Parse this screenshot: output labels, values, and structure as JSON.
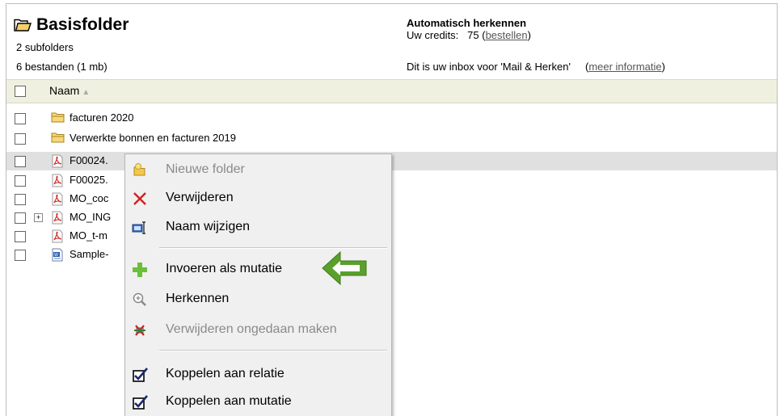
{
  "header": {
    "title": "Basisfolder",
    "subfolders": "2 subfolders",
    "files": "6 bestanden (1 mb)",
    "auto_title": "Automatisch herkennen",
    "credits_label": "Uw credits:",
    "credits_value": "75",
    "order_link": "bestellen",
    "inbox_text": "Dit is uw inbox voor 'Mail & Herken'",
    "more_info_link": "meer informatie"
  },
  "table": {
    "column_name": "Naam",
    "rows": [
      {
        "label": "facturen 2020",
        "icon": "folder-icon"
      },
      {
        "label": "Verwerkte bonnen en facturen 2019",
        "icon": "folder-icon"
      },
      {
        "label": "F00024.",
        "icon": "pdf-icon"
      },
      {
        "label": "F00025.",
        "icon": "pdf-icon"
      },
      {
        "label": "MO_coc",
        "icon": "pdf-icon"
      },
      {
        "label": "MO_ING",
        "icon": "pdf-icon"
      },
      {
        "label": "MO_t-m",
        "icon": "pdf-icon"
      },
      {
        "label": "Sample-",
        "icon": "word-doc-icon"
      }
    ]
  },
  "context_menu": {
    "items": [
      {
        "label": "Nieuwe folder",
        "enabled": false,
        "icon": "new-folder-icon"
      },
      {
        "label": "Verwijderen",
        "enabled": true,
        "icon": "delete-x-icon"
      },
      {
        "label": "Naam wijzigen",
        "enabled": true,
        "icon": "rename-icon"
      },
      {
        "label": "Invoeren als mutatie",
        "enabled": true,
        "icon": "add-plus-icon"
      },
      {
        "label": "Herkennen",
        "enabled": true,
        "icon": "magnify-icon"
      },
      {
        "label": "Verwijderen ongedaan maken",
        "enabled": false,
        "icon": "undo-delete-icon"
      },
      {
        "label": "Koppelen aan relatie",
        "enabled": true,
        "icon": "checkbox-check-icon"
      },
      {
        "label": "Koppelen aan mutatie",
        "enabled": true,
        "icon": "checkbox-check-icon"
      }
    ]
  },
  "colors": {
    "highlight_arrow": "#5aa02c",
    "delete_red": "#d42020",
    "plus_green": "#6cbf3a",
    "header_bar": "#f0f0e0"
  }
}
